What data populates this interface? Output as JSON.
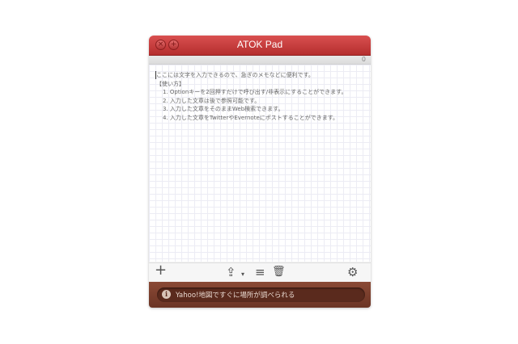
{
  "window": {
    "title": "ATOK Pad",
    "close_glyph": "×",
    "add_glyph": "+",
    "char_count": "0"
  },
  "note": {
    "lines": [
      "ここには文字を入力できるので、急ぎのメモなどに便利です。",
      "【使い方】",
      "1. Optionキーを2回押すだけで呼び出す/非表示にすることができます。",
      "2. 入力した文章は後で参照可能です。",
      "3. 入力した文章をそのままWeb検索できます。",
      "4. 入力した文章をTwitterやEvernoteにポストすることができます。"
    ]
  },
  "toolbar": {
    "add": "+",
    "share": "⇪",
    "share_caret": "▾",
    "list": "≡",
    "trash": "🗑",
    "settings": "⚙"
  },
  "status": {
    "info_glyph": "i",
    "message": "Yahoo!地図ですぐに場所が調べられる"
  }
}
